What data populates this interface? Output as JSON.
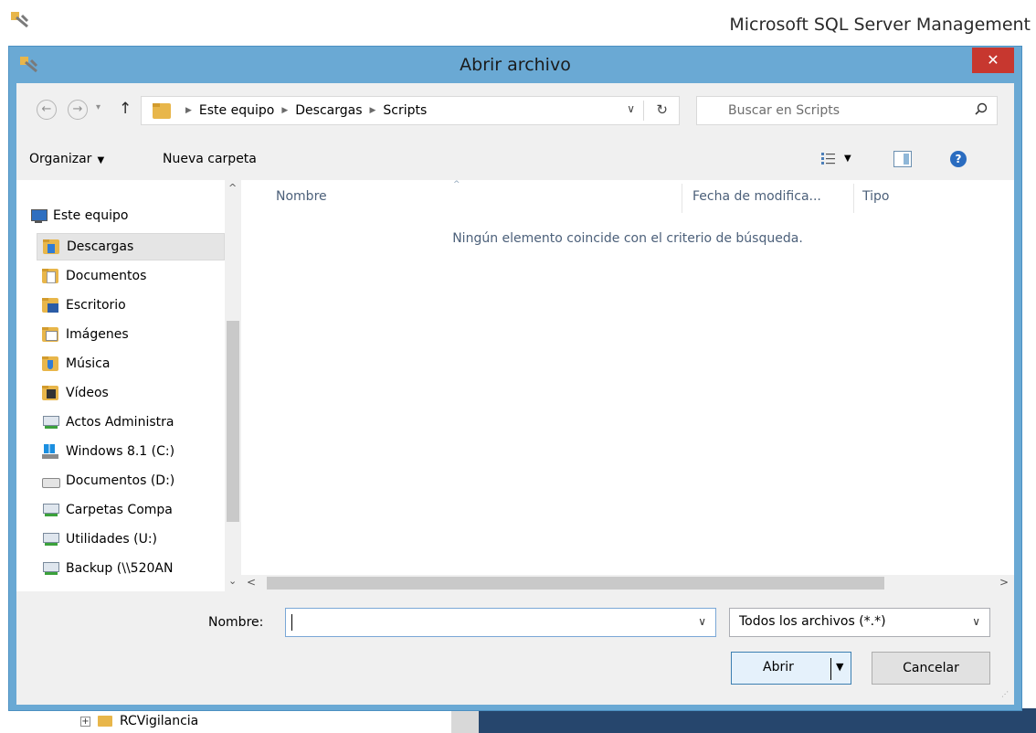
{
  "background": {
    "app_title": "Microsoft SQL Server Management",
    "tree_item": "RCVigilancia",
    "tree_expander": "+"
  },
  "dialog": {
    "title": "Abrir archivo",
    "close_glyph": "✕"
  },
  "nav": {
    "back_glyph": "←",
    "forward_glyph": "→",
    "dropdown_glyph": "▾",
    "up_glyph": "↑",
    "breadcrumbs": [
      "Este equipo",
      "Descargas",
      "Scripts"
    ],
    "crumb_separator": "▶",
    "address_dropdown_glyph": "∨",
    "refresh_glyph": "↻",
    "search_placeholder": "Buscar en Scripts"
  },
  "toolbar": {
    "organize_label": "Organizar",
    "organize_caret": "▼",
    "new_folder_label": "Nueva carpeta",
    "view_caret": "▼",
    "help_glyph": "?"
  },
  "sidebar": {
    "root": {
      "label": "Este equipo",
      "icon": "computer-icon"
    },
    "items": [
      {
        "label": "Descargas",
        "icon": "downloads-folder-icon",
        "selected": true
      },
      {
        "label": "Documentos",
        "icon": "documents-folder-icon"
      },
      {
        "label": "Escritorio",
        "icon": "desktop-folder-icon"
      },
      {
        "label": "Imágenes",
        "icon": "pictures-folder-icon"
      },
      {
        "label": "Música",
        "icon": "music-folder-icon"
      },
      {
        "label": "Vídeos",
        "icon": "videos-folder-icon"
      },
      {
        "label": "Actos Administra",
        "icon": "network-drive-icon"
      },
      {
        "label": "Windows 8.1 (C:)",
        "icon": "windows-drive-icon"
      },
      {
        "label": "Documentos (D:)",
        "icon": "local-drive-icon"
      },
      {
        "label": "Carpetas Compa",
        "icon": "network-drive-icon"
      },
      {
        "label": "Utilidades (U:)",
        "icon": "network-drive-icon"
      },
      {
        "label": "Backup (\\\\520AN",
        "icon": "network-drive-icon"
      }
    ],
    "scroll_up": "^",
    "scroll_down": "⌄"
  },
  "file_list": {
    "columns": [
      "Nombre",
      "Fecha de modifica...",
      "Tipo"
    ],
    "sort_glyph": "^",
    "empty_message": "Ningún elemento coincide con el criterio de búsqueda.",
    "scroll_left": "<",
    "scroll_right": ">"
  },
  "bottom": {
    "filename_label": "Nombre:",
    "filename_value": "",
    "filename_dropdown_glyph": "∨",
    "filter_value": "Todos los archivos (*.*)",
    "filter_dropdown_glyph": "∨",
    "open_label": "Abrir",
    "open_arrow": "▼",
    "cancel_label": "Cancelar"
  },
  "colors": {
    "dialog_frame": "#6aa9d4",
    "close_button": "#c7372f",
    "selection": "#e5e5e5",
    "primary_button": "#e5f1fb",
    "primary_border": "#3c7fb1"
  }
}
